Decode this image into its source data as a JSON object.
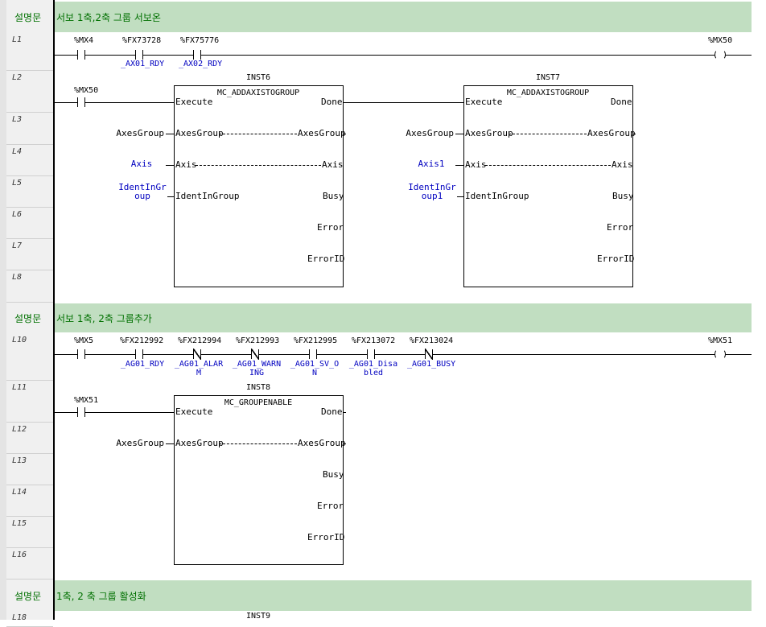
{
  "comments": {
    "c1_label": "설명문",
    "c1_text": "서보 1축,2축 그룹 서보온",
    "c2_label": "설명문",
    "c2_text": "서보 1축, 2축 그룹추가",
    "c3_label": "설명문",
    "c3_text": "1축, 2 축 그룹 활성화"
  },
  "lines": [
    "L1",
    "L2",
    "L3",
    "L4",
    "L5",
    "L6",
    "L7",
    "L8",
    "L10",
    "L11",
    "L12",
    "L13",
    "L14",
    "L15",
    "L16",
    "L18"
  ],
  "rung1": {
    "contacts": [
      {
        "var": "%MX4",
        "comment": ""
      },
      {
        "var": "%FX73728",
        "comment": "_AX01_RDY"
      },
      {
        "var": "%FX75776",
        "comment": "_AX02_RDY"
      }
    ],
    "coil": "%MX50"
  },
  "rung2": {
    "contact": "%MX50",
    "fb1": {
      "instance": "INST6",
      "type": "MC_ADDAXISTOGROUP",
      "axesgroup": "AxesGroup",
      "axis": "Axis",
      "ident": "IdentInGroup"
    },
    "fb2": {
      "instance": "INST7",
      "type": "MC_ADDAXISTOGROUP",
      "axesgroup": "AxesGroup",
      "axis": "Axis1",
      "ident": "IdentInGroup1"
    },
    "pins": {
      "execute": "Execute",
      "done": "Done",
      "axesgroup": "AxesGroup",
      "axis": "Axis",
      "ident": "IdentInGroup",
      "busy": "Busy",
      "error": "Error",
      "errorid": "ErrorID"
    }
  },
  "rung3": {
    "contacts": [
      {
        "var": "%MX5",
        "comment": "",
        "type": "no"
      },
      {
        "var": "%FX212992",
        "comment": "_AG01_RDY",
        "type": "no"
      },
      {
        "var": "%FX212994",
        "comment": "_AG01_ALARM",
        "type": "nc"
      },
      {
        "var": "%FX212993",
        "comment": "_AG01_WARNING",
        "type": "nc"
      },
      {
        "var": "%FX212995",
        "comment": "_AG01_SV_ON",
        "type": "no"
      },
      {
        "var": "%FX213072",
        "comment": "_AG01_Disabled",
        "type": "no"
      },
      {
        "var": "%FX213024",
        "comment": "_AG01_BUSY",
        "type": "nc"
      }
    ],
    "coil": "%MX51"
  },
  "rung4": {
    "contact": "%MX51",
    "fb": {
      "instance": "INST8",
      "type": "MC_GROUPENABLE",
      "axesgroup": "AxesGroup"
    },
    "pins": {
      "execute": "Execute",
      "done": "Done",
      "axesgroup": "AxesGroup",
      "busy": "Busy",
      "error": "Error",
      "errorid": "ErrorID"
    }
  },
  "rung5": {
    "instance": "INST9"
  }
}
